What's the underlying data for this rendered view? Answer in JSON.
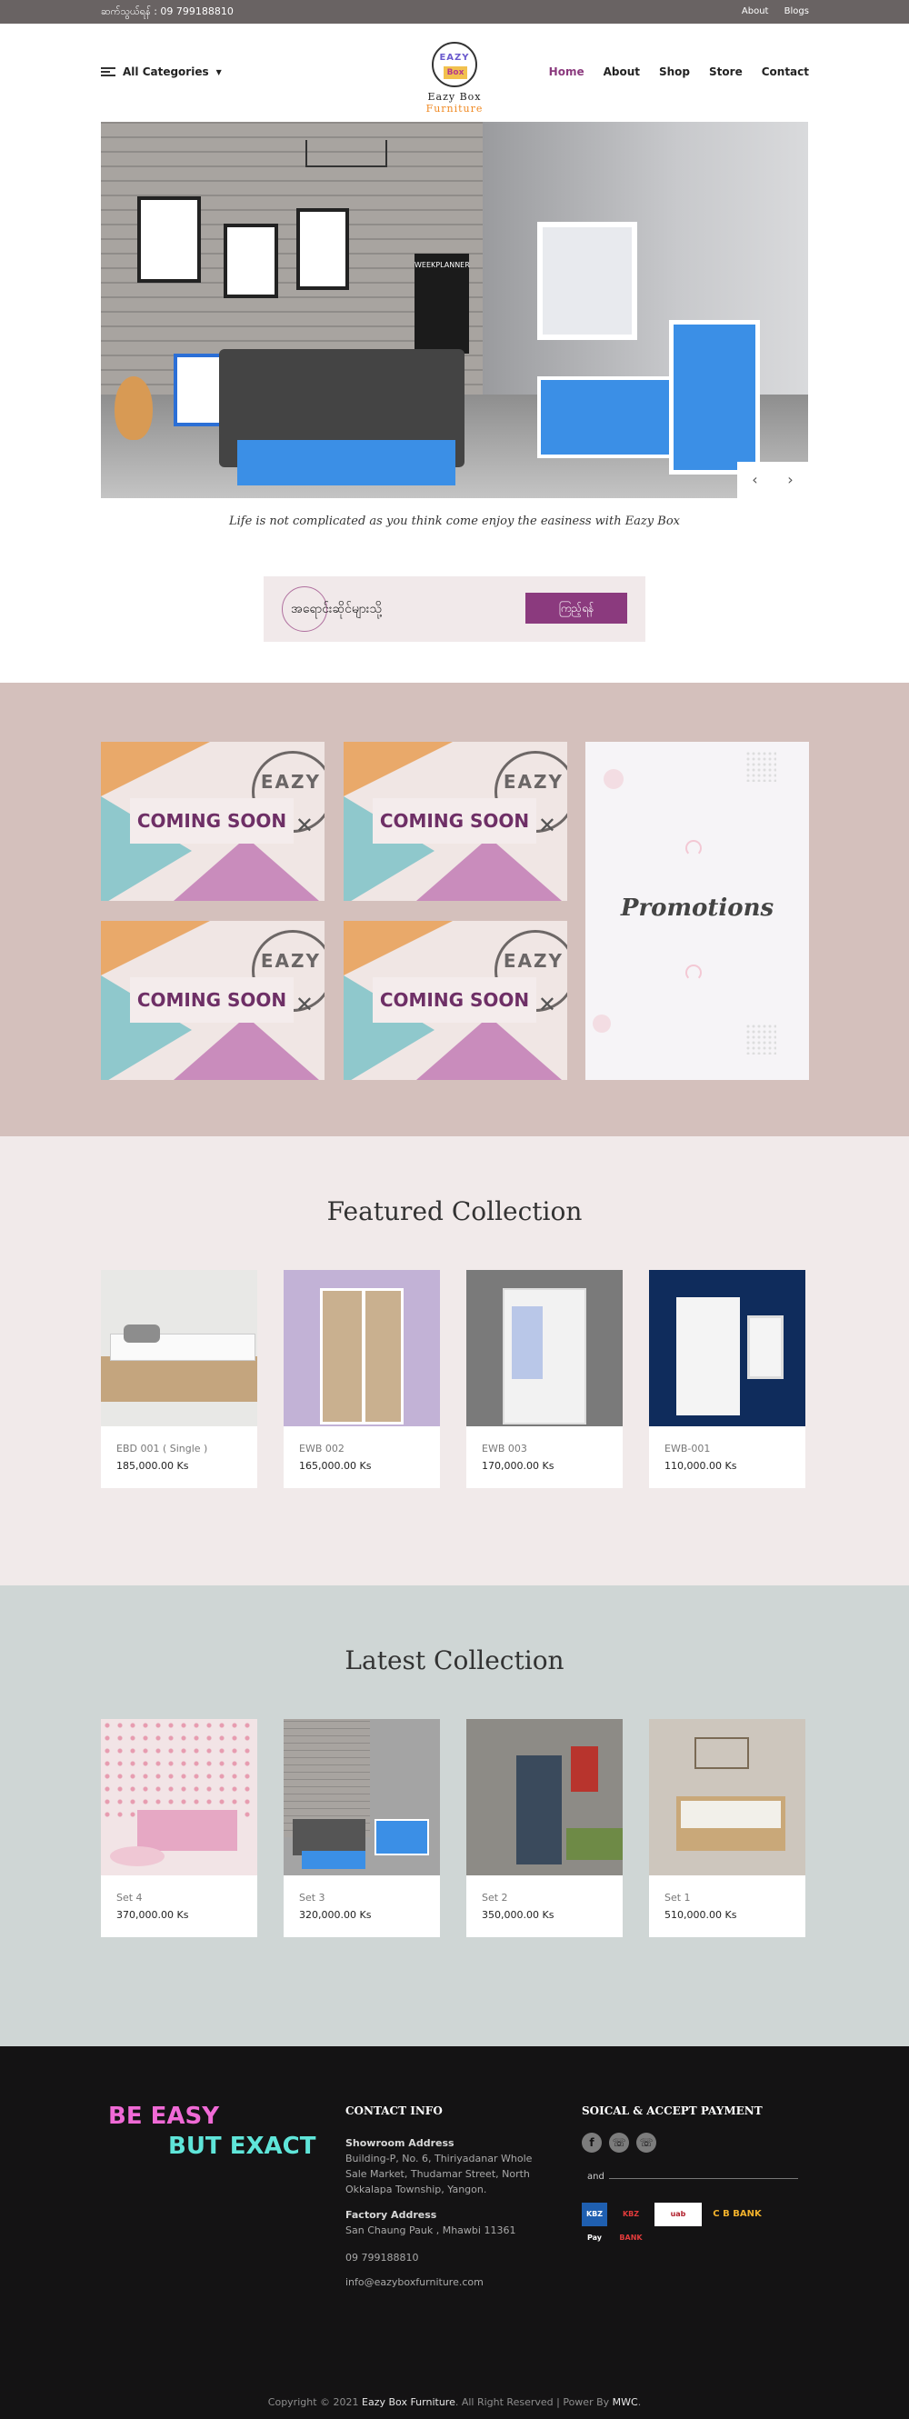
{
  "topbar": {
    "phone": "ဆက်သွယ်ရန် : 09 799188810",
    "links": [
      "About",
      "Blogs"
    ]
  },
  "header": {
    "categories_label": "All Categories",
    "logo": {
      "line1": "EAZY",
      "line2": "Box",
      "word1": "Eazy Box",
      "word2": "Furniture"
    },
    "nav": [
      "Home",
      "About",
      "Shop",
      "Store",
      "Contact"
    ]
  },
  "hero": {
    "planner_text": "WEEKPLANNER",
    "prev_icon": "‹",
    "next_icon": "›"
  },
  "tagline": "Life is not complicated as you think come enjoy the easiness with Eazy Box",
  "store_box": {
    "label": "အရောင်းဆိုင်များသို့",
    "button": "ကြည့်ရန်"
  },
  "promo": {
    "tiles": [
      {
        "label": "COMING SOON",
        "brand": "EAZY"
      },
      {
        "label": "COMING SOON",
        "brand": "EAZY"
      },
      {
        "label": "COMING SOON",
        "brand": "EAZY"
      },
      {
        "label": "COMING SOON",
        "brand": "EAZY"
      }
    ],
    "card_title": "Promotions"
  },
  "featured": {
    "title": "Featured Collection",
    "items": [
      {
        "name": "EBD 001 ( Single )",
        "price": "185,000.00 Ks",
        "bg": "#e8e8e6"
      },
      {
        "name": "EWB 002",
        "price": "165,000.00 Ks",
        "bg": "#c2b2d6"
      },
      {
        "name": "EWB 003",
        "price": "170,000.00 Ks",
        "bg": "#7a7a7a"
      },
      {
        "name": "EWB-001",
        "price": "110,000.00 Ks",
        "bg": "#0f2c5c"
      }
    ]
  },
  "latest": {
    "title": "Latest Collection",
    "items": [
      {
        "name": "Set 4",
        "price": "370,000.00 Ks",
        "bg": "#f2e4e6"
      },
      {
        "name": "Set 3",
        "price": "320,000.00 Ks",
        "bg": "#a4a4a4"
      },
      {
        "name": "Set 2",
        "price": "350,000.00 Ks",
        "bg": "#8d8b86"
      },
      {
        "name": "Set 1",
        "price": "510,000.00 Ks",
        "bg": "#cdc6bd"
      }
    ]
  },
  "footer": {
    "slogan_line1": "BE EASY",
    "slogan_line2": "BUT EXACT",
    "contact_head": "CONTACT INFO",
    "showroom_label": "Showroom Address",
    "showroom_text": "Building-P, No. 6, Thiriyadanar Whole Sale Market, Thudamar Street, North Okkalapa Township, Yangon.",
    "factory_label": "Factory Address",
    "factory_text": "San Chaung Pauk , Mhawbi 11361",
    "phone": "09 799188810",
    "email": "info@eazyboxfurniture.com",
    "social_head": "SOICAL & ACCEPT PAYMENT",
    "and_label": "and",
    "payments": [
      "KBZ Pay",
      "KBZ BANK",
      "uab",
      "C B BANK"
    ],
    "copyright_pre": "Copyright © 2021",
    "copyright_brand": "Eazy Box Furniture",
    "copyright_mid": ". All Right Reserved | Power By",
    "copyright_power": "MWC"
  }
}
